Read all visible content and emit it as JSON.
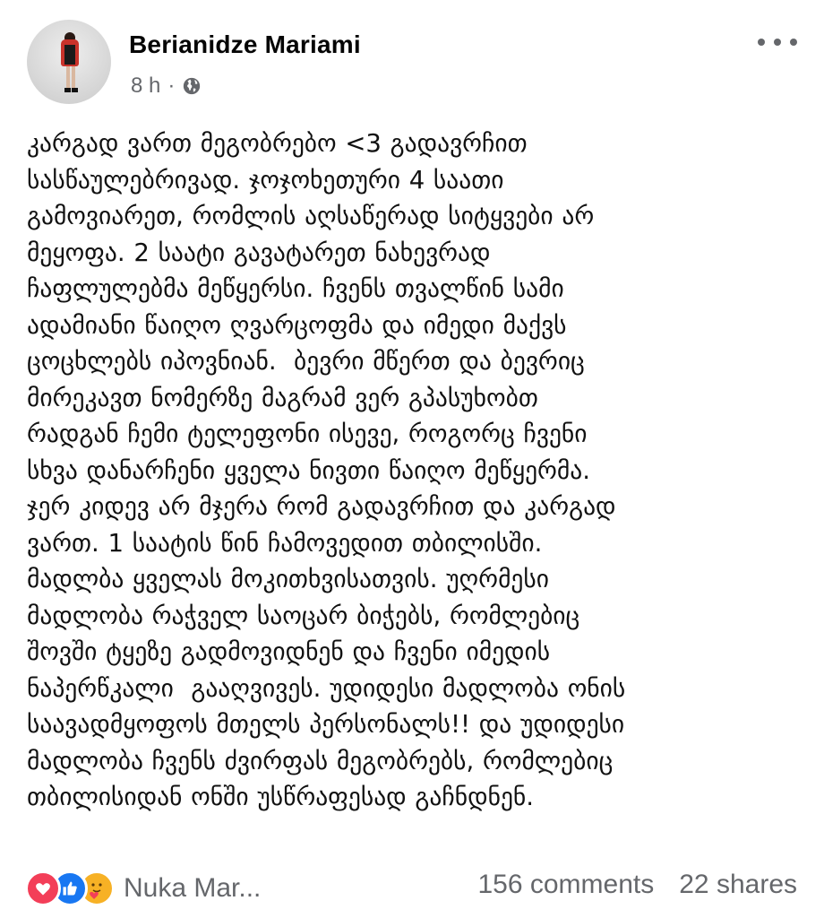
{
  "post": {
    "author": "Berianidze Mariami",
    "time": "8 h",
    "separator": "·",
    "privacy_icon": "globe-icon",
    "more_icon": "more-options-icon",
    "lines": [
      "კარგად ვართ მეგობრებო <3 გადავრჩით",
      "სასწაულებრივად. ჯოჯოხეთური 4 საათი",
      "გამოვიარეთ, რომლის აღსაწერად სიტყვები არ",
      "მეყოფა. 2 საატი გავატარეთ ნახევრად",
      "ჩაფლულებმა მეწყერსი. ჩვენს თვალწინ სამი",
      "ადამიანი წაიღო ღვარცოფმა და იმედი მაქვს",
      "ცოცხლებს იპოვნიან.  ბევრი მწერთ და ბევრიც",
      "მირეკავთ ნომერზე მაგრამ ვერ გპასუხობთ",
      "რადგან ჩემი ტელეფონი ისევე, როგორც ჩვენი",
      "სხვა დანარჩენი ყველა ნივთი წაიღო მეწყერმა.",
      "ჯერ კიდევ არ მჯერა რომ გადავრჩით და კარგად",
      "ვართ. 1 საატის წინ ჩამოვედით თბილისში.",
      "მადლბა ყველას მოკითხვისათვის. უღრმესი",
      "მადლობა რაჭველ საოცარ ბიჭებს, რომლებიც",
      "შოვში ტყეზე გადმოვიდნენ და ჩვენი იმედის",
      "ნაპერწკალი  გააღვივეს. უდიდესი მადლობა ონის",
      "საავადმყოფოს მთელს პერსონალს!! და უდიდესი",
      "მადლობა ჩვენს ძვირფას მეგობრებს, რომლებიც",
      "თბილისიდან ონში უსწრაფესად გაჩნდნენ."
    ]
  },
  "reactions": {
    "icons": [
      "love-reaction-icon",
      "like-reaction-icon",
      "care-reaction-icon"
    ],
    "names": "Nuka Mar..."
  },
  "counts": {
    "comments": "156 comments",
    "shares": "22 shares"
  },
  "colors": {
    "secondary_text": "#65676b",
    "like_blue": "#1877f2",
    "love_red": "#f33e58",
    "care_yellow": "#f7b125"
  }
}
